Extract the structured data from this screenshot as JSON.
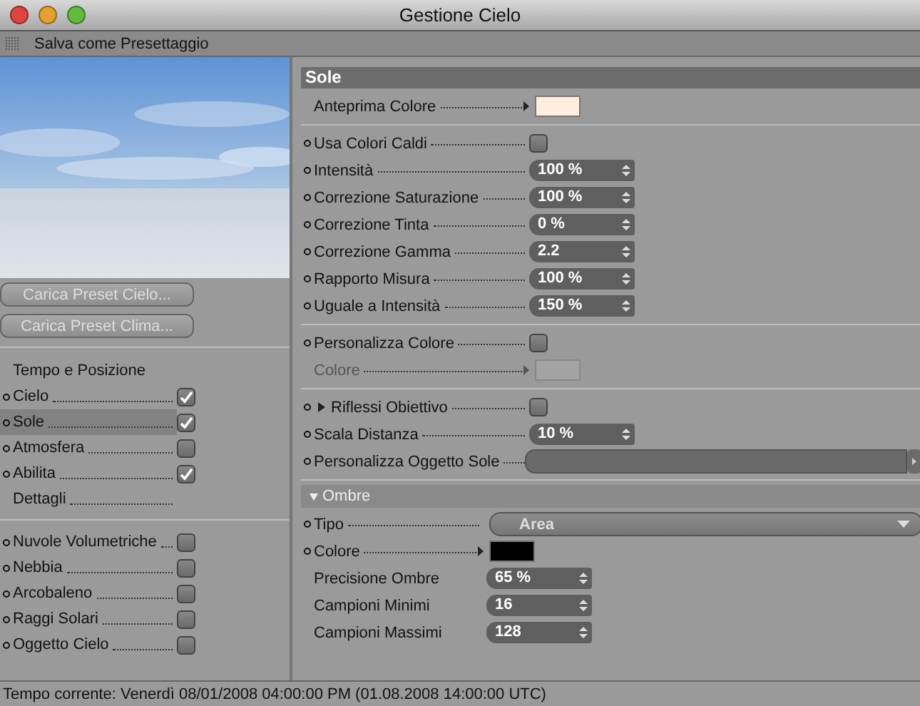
{
  "window": {
    "title": "Gestione Cielo"
  },
  "toolbar": {
    "menu": "Salva come Presettaggio"
  },
  "preview": {
    "kind": "picture"
  },
  "preset_buttons": [
    "Carica Preset Cielo...",
    "Carica Preset Clima..."
  ],
  "sections": [
    [
      {
        "kind": "heading",
        "label": "Tempo e Posizione"
      },
      {
        "kind": "check",
        "label": "Cielo",
        "dot": true,
        "checked": true,
        "selected": false
      },
      {
        "kind": "check",
        "label": "Sole",
        "dot": true,
        "checked": true,
        "selected": true
      },
      {
        "kind": "check",
        "label": "Atmosfera",
        "dot": true,
        "checked": false,
        "selected": false
      },
      {
        "kind": "check",
        "label": "Abilita",
        "dot": true,
        "checked": true,
        "selected": false
      },
      {
        "kind": "link",
        "label": "Dettagli",
        "dot": false,
        "selected": false
      }
    ],
    [
      {
        "kind": "check",
        "label": "Nuvole Volumetriche",
        "dot": true,
        "checked": false,
        "selected": false
      },
      {
        "kind": "check",
        "label": "Nebbia",
        "dot": true,
        "checked": false,
        "selected": false
      },
      {
        "kind": "check",
        "label": "Arcobaleno",
        "dot": true,
        "checked": false,
        "selected": false
      },
      {
        "kind": "check",
        "label": "Raggi Solari",
        "dot": true,
        "checked": false,
        "selected": false
      },
      {
        "kind": "check",
        "label": "Oggetto Cielo",
        "dot": true,
        "checked": false,
        "selected": false
      }
    ]
  ],
  "panel": {
    "title": "Sole",
    "groups": [
      [
        {
          "kind": "color",
          "label": "Anteprima Colore",
          "dot": false,
          "color": "#ffeedd",
          "disabled": false
        }
      ],
      [
        {
          "kind": "checkbox",
          "label": "Usa Colori Caldi",
          "dot": true,
          "checked": false
        },
        {
          "kind": "number",
          "label": "Intensità",
          "dot": true,
          "value": "100 %"
        },
        {
          "kind": "number",
          "label": "Correzione Saturazione",
          "dot": true,
          "value": "100 %"
        },
        {
          "kind": "number",
          "label": "Correzione Tinta",
          "dot": true,
          "value": "0 %"
        },
        {
          "kind": "number",
          "label": "Correzione Gamma",
          "dot": true,
          "value": "2.2"
        },
        {
          "kind": "number",
          "label": "Rapporto Misura",
          "dot": true,
          "value": "100 %"
        },
        {
          "kind": "number",
          "label": "Uguale a Intensità",
          "dot": true,
          "value": "150 %"
        }
      ],
      [
        {
          "kind": "checkbox",
          "label": "Personalizza Colore",
          "dot": true,
          "checked": false
        },
        {
          "kind": "color",
          "label": "Colore",
          "dot": false,
          "color": "#a3a3a3",
          "disabled": true
        }
      ],
      [
        {
          "kind": "checkbox",
          "label": "Riflessi Obiettivo",
          "dot": true,
          "checked": false,
          "expanded": false
        },
        {
          "kind": "number",
          "label": "Scala Distanza",
          "dot": true,
          "value": "10 %"
        },
        {
          "kind": "link",
          "label": "Personalizza Oggetto Sole",
          "dot": true
        }
      ]
    ],
    "subsection": {
      "title": "Ombre",
      "expanded": true,
      "rows": [
        {
          "kind": "dropdown",
          "label": "Tipo",
          "dot": true,
          "value": "Area"
        },
        {
          "kind": "color",
          "label": "Colore",
          "dot": true,
          "color": "#000000",
          "disabled": false
        },
        {
          "kind": "number",
          "label": "Precisione Ombre",
          "dot": false,
          "value": "65 %"
        },
        {
          "kind": "number",
          "label": "Campioni Minimi",
          "dot": false,
          "value": "16"
        },
        {
          "kind": "number",
          "label": "Campioni Massimi",
          "dot": false,
          "value": "128"
        }
      ]
    }
  },
  "status_bar": "Tempo corrente:  Venerdì  08/01/2008 04:00:00 PM  (01.08.2008  14:00:00 UTC)"
}
